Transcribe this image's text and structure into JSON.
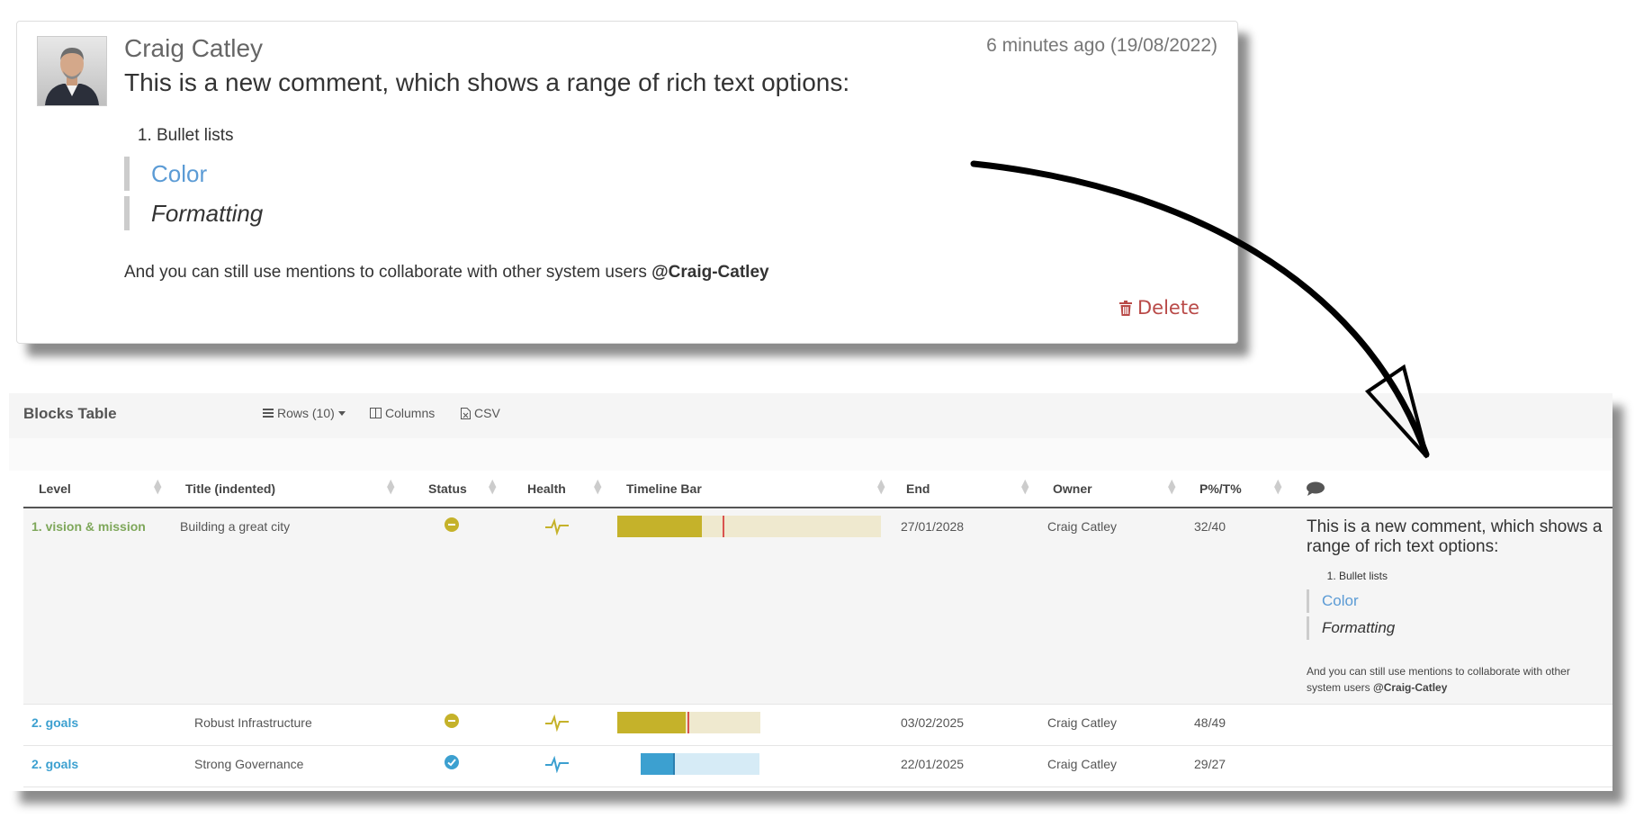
{
  "comment": {
    "author": "Craig Catley",
    "timestamp": "6 minutes ago (19/08/2022)",
    "heading": "This is a new comment, which shows a range of rich text options:",
    "list_items": [
      "Bullet lists"
    ],
    "quote_color": "Color",
    "quote_formatting": "Formatting",
    "mentions_text": "And you can still use mentions to collaborate with other system users ",
    "mention": "@Craig-Catley",
    "delete_label": "Delete",
    "delete_color": "#b94a48",
    "color_text_color": "#5b9bd5"
  },
  "table": {
    "title": "Blocks Table",
    "toolbar": {
      "rows_label": "Rows (10)",
      "columns_label": "Columns",
      "csv_label": "CSV"
    },
    "headers": {
      "level": "Level",
      "title": "Title (indented)",
      "status": "Status",
      "health": "Health",
      "timeline": "Timeline Bar",
      "end": "End",
      "owner": "Owner",
      "pt": "P%/T%",
      "comment_icon": "comment-icon"
    },
    "rows": [
      {
        "level": "1. vision & mission",
        "title": "Building a great city",
        "status": "amber",
        "health": "amber",
        "timeline": {
          "progress_pct": 32,
          "time_pct": 40,
          "color": "#c5b22a",
          "track_color": "#efe9cf"
        },
        "end": "27/01/2028",
        "owner": "Craig Catley",
        "pt": "32/40",
        "comment": {
          "heading": "This is a new comment, which shows a range of rich text options:",
          "list_items": [
            "Bullet lists"
          ],
          "quote_color": "Color",
          "quote_formatting": "Formatting",
          "mentions_text": "And you can still use mentions to collaborate with other system users ",
          "mention": "@Craig-Catley"
        }
      },
      {
        "level": "2. goals",
        "title": "Robust Infrastructure",
        "status": "amber",
        "health": "amber",
        "timeline": {
          "progress_pct": 48,
          "time_pct": 49,
          "color": "#c5b22a",
          "track_color": "#efe9cf"
        },
        "end": "03/02/2025",
        "owner": "Craig Catley",
        "pt": "48/49"
      },
      {
        "level": "2. goals",
        "title": "Strong Governance",
        "status": "blue-check",
        "health": "blue",
        "timeline": {
          "progress_pct": 29,
          "time_pct": 27,
          "color": "#3ca0d0",
          "track_color": "#d6ebf6"
        },
        "end": "22/01/2025",
        "owner": "Craig Catley",
        "pt": "29/27"
      }
    ]
  },
  "colors": {
    "amber": "#c5b22a",
    "blue": "#3ca0d0",
    "green_level": "#7ea75a"
  }
}
